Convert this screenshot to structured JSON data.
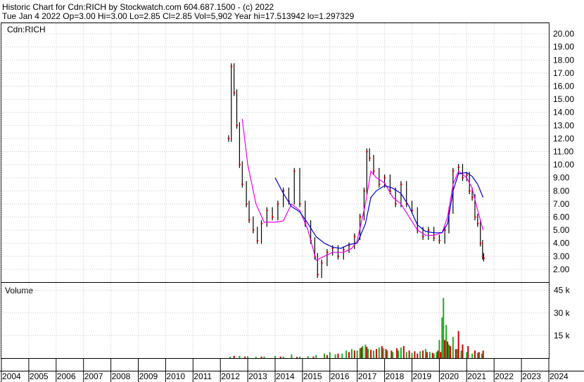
{
  "header": {
    "line1": "Historic Chart for Cdn:RICH by Stockwatch.com 604.687.1500 - (c) 2022",
    "line2": "Tue Jan  4 2022   Op=3.00  Hi=3.00  Lo=2.85  Cl=2.85  Vol=5,902  Year hi=17.513942  lo=1.297329"
  },
  "price_panel": {
    "label": "Cdn:RICH"
  },
  "volume_panel": {
    "label": "Volume"
  },
  "colors": {
    "price": "#000000",
    "close_marker": "#dd0000",
    "ma_short": "#ee00ee",
    "ma_long": "#0000cc",
    "vol_up": "#22aa22",
    "vol_down": "#cc0000"
  },
  "chart_data": [
    {
      "type": "line",
      "title": "Cdn:RICH",
      "x_ticks": [
        "2004",
        "2005",
        "2006",
        "2007",
        "2008",
        "2009",
        "2010",
        "2011",
        "2012",
        "2013",
        "2014",
        "2015",
        "2016",
        "2017",
        "2018",
        "2019",
        "2020",
        "2021",
        "2022",
        "2023",
        "2024"
      ],
      "xlim": [
        2004,
        2024
      ],
      "y_ticks": [
        "20.00",
        "19.00",
        "18.00",
        "17.00",
        "16.00",
        "15.00",
        "14.00",
        "13.00",
        "12.00",
        "11.00",
        "10.00",
        "9.00",
        "8.00",
        "7.00",
        "6.00",
        "5.00",
        "4.00",
        "3.00",
        "2.00"
      ],
      "ylim": [
        1.0,
        20.6
      ],
      "grid": true,
      "series": [
        {
          "values": [
            [
              2012.3,
              12.0
            ],
            [
              2012.4,
              17.5
            ],
            [
              2012.5,
              15.5
            ],
            [
              2012.6,
              13.0
            ],
            [
              2012.7,
              10.0
            ],
            [
              2012.8,
              8.5
            ],
            [
              2012.95,
              7.0
            ],
            [
              2013.05,
              5.8
            ],
            [
              2013.2,
              5.0
            ],
            [
              2013.35,
              4.2
            ],
            [
              2013.5,
              5.5
            ],
            [
              2013.7,
              6.5
            ],
            [
              2013.9,
              6.0
            ],
            [
              2014.1,
              7.0
            ],
            [
              2014.3,
              8.0
            ],
            [
              2014.5,
              7.2
            ],
            [
              2014.7,
              9.5
            ],
            [
              2014.9,
              7.0
            ],
            [
              2015.1,
              5.5
            ],
            [
              2015.3,
              4.2
            ],
            [
              2015.45,
              3.0
            ],
            [
              2015.55,
              1.6
            ],
            [
              2015.7,
              2.5
            ],
            [
              2015.9,
              3.3
            ],
            [
              2016.1,
              3.6
            ],
            [
              2016.3,
              3.0
            ],
            [
              2016.5,
              3.5
            ],
            [
              2016.7,
              3.8
            ],
            [
              2016.9,
              4.5
            ],
            [
              2017.1,
              6.0
            ],
            [
              2017.25,
              8.0
            ],
            [
              2017.35,
              11.0
            ],
            [
              2017.45,
              10.5
            ],
            [
              2017.6,
              9.5
            ],
            [
              2017.8,
              8.5
            ],
            [
              2018.0,
              9.0
            ],
            [
              2018.2,
              8.0
            ],
            [
              2018.4,
              7.0
            ],
            [
              2018.6,
              8.5
            ],
            [
              2018.8,
              7.0
            ],
            [
              2019.0,
              6.5
            ],
            [
              2019.2,
              5.0
            ],
            [
              2019.4,
              4.5
            ],
            [
              2019.6,
              5.0
            ],
            [
              2019.8,
              4.4
            ],
            [
              2020.0,
              4.2
            ],
            [
              2020.2,
              5.0
            ],
            [
              2020.35,
              6.5
            ],
            [
              2020.5,
              9.5
            ],
            [
              2020.7,
              9.8
            ],
            [
              2020.85,
              9.0
            ],
            [
              2021.0,
              9.2
            ],
            [
              2021.1,
              8.0
            ],
            [
              2021.2,
              7.5
            ],
            [
              2021.3,
              6.0
            ],
            [
              2021.4,
              5.5
            ],
            [
              2021.5,
              4.0
            ],
            [
              2021.58,
              3.0
            ],
            [
              2021.62,
              2.85
            ]
          ]
        },
        {
          "name": "",
          "values": [
            [
              2012.8,
              13.5
            ],
            [
              2013.0,
              10.0
            ],
            [
              2013.3,
              7.0
            ],
            [
              2013.6,
              5.6
            ],
            [
              2014.0,
              5.6
            ],
            [
              2014.3,
              5.7
            ],
            [
              2014.6,
              7.0
            ],
            [
              2014.9,
              6.5
            ],
            [
              2015.2,
              5.0
            ],
            [
              2015.5,
              2.7
            ],
            [
              2015.8,
              3.0
            ],
            [
              2016.1,
              3.3
            ],
            [
              2016.5,
              3.3
            ],
            [
              2016.8,
              3.6
            ],
            [
              2017.0,
              4.2
            ],
            [
              2017.3,
              7.0
            ],
            [
              2017.5,
              9.5
            ],
            [
              2017.7,
              9.0
            ],
            [
              2018.0,
              8.6
            ],
            [
              2018.3,
              7.5
            ],
            [
              2018.6,
              7.0
            ],
            [
              2018.9,
              6.0
            ],
            [
              2019.2,
              5.0
            ],
            [
              2019.5,
              4.6
            ],
            [
              2019.8,
              4.6
            ],
            [
              2020.1,
              4.8
            ],
            [
              2020.3,
              6.0
            ],
            [
              2020.5,
              8.5
            ],
            [
              2020.7,
              9.5
            ],
            [
              2021.0,
              9.0
            ],
            [
              2021.2,
              8.2
            ],
            [
              2021.4,
              6.5
            ],
            [
              2021.6,
              5.0
            ]
          ]
        },
        {
          "name": "",
          "values": [
            [
              2014.0,
              9.0
            ],
            [
              2014.3,
              7.8
            ],
            [
              2014.6,
              6.8
            ],
            [
              2014.9,
              6.4
            ],
            [
              2015.2,
              5.5
            ],
            [
              2015.5,
              4.5
            ],
            [
              2015.8,
              4.0
            ],
            [
              2016.1,
              3.7
            ],
            [
              2016.4,
              3.6
            ],
            [
              2016.7,
              3.9
            ],
            [
              2017.0,
              4.0
            ],
            [
              2017.3,
              5.5
            ],
            [
              2017.5,
              7.5
            ],
            [
              2017.7,
              8.0
            ],
            [
              2018.0,
              8.4
            ],
            [
              2018.3,
              8.2
            ],
            [
              2018.6,
              7.8
            ],
            [
              2018.9,
              6.8
            ],
            [
              2019.2,
              5.4
            ],
            [
              2019.5,
              4.9
            ],
            [
              2019.8,
              4.8
            ],
            [
              2020.1,
              4.8
            ],
            [
              2020.3,
              5.5
            ],
            [
              2020.5,
              8.0
            ],
            [
              2020.7,
              9.3
            ],
            [
              2021.0,
              9.4
            ],
            [
              2021.2,
              9.1
            ],
            [
              2021.4,
              8.5
            ],
            [
              2021.6,
              7.5
            ]
          ]
        }
      ]
    },
    {
      "type": "bar",
      "title": "Volume",
      "y_ticks": [
        "45 k",
        "30 k",
        "15 k"
      ],
      "ylim": [
        0,
        50
      ],
      "grid": true,
      "series": [
        {
          "values": [
            [
              2012.35,
              1.0
            ],
            [
              2012.7,
              1.5
            ],
            [
              2013.0,
              1.2
            ],
            [
              2013.3,
              0.8
            ],
            [
              2013.6,
              1.0
            ],
            [
              2014.0,
              1.5
            ],
            [
              2014.3,
              1.0
            ],
            [
              2014.6,
              2.5
            ],
            [
              2014.9,
              1.0
            ],
            [
              2015.2,
              1.2
            ],
            [
              2015.5,
              2.0
            ],
            [
              2015.8,
              3.0
            ],
            [
              2016.0,
              4.0
            ],
            [
              2016.2,
              2.5
            ],
            [
              2016.45,
              3.0
            ],
            [
              2016.6,
              5.0
            ],
            [
              2016.8,
              6.0
            ],
            [
              2017.0,
              5.0
            ],
            [
              2017.1,
              6.5
            ],
            [
              2017.2,
              8.0
            ],
            [
              2017.3,
              9.0
            ],
            [
              2017.4,
              6.0
            ],
            [
              2017.6,
              5.0
            ],
            [
              2017.8,
              7.0
            ],
            [
              2017.95,
              6.5
            ],
            [
              2018.1,
              5.0
            ],
            [
              2018.3,
              4.0
            ],
            [
              2018.5,
              5.0
            ],
            [
              2018.6,
              7.0
            ],
            [
              2018.8,
              4.0
            ],
            [
              2019.0,
              3.5
            ],
            [
              2019.3,
              4.5
            ],
            [
              2019.5,
              6.0
            ],
            [
              2019.65,
              4.0
            ],
            [
              2019.8,
              3.0
            ],
            [
              2019.9,
              4.0
            ],
            [
              2020.0,
              12.0
            ],
            [
              2020.1,
              27.0
            ],
            [
              2020.15,
              40.0
            ],
            [
              2020.25,
              22.0
            ],
            [
              2020.35,
              9.0
            ],
            [
              2020.5,
              14.0
            ],
            [
              2020.65,
              6.0
            ],
            [
              2020.8,
              5.0
            ],
            [
              2021.0,
              4.0
            ],
            [
              2021.2,
              3.0
            ],
            [
              2021.4,
              3.5
            ],
            [
              2021.55,
              3.0
            ]
          ]
        },
        {
          "values": [
            [
              2012.5,
              1.5
            ],
            [
              2012.9,
              1.0
            ],
            [
              2013.5,
              1.0
            ],
            [
              2014.2,
              1.0
            ],
            [
              2014.8,
              0.8
            ],
            [
              2015.4,
              1.0
            ],
            [
              2015.9,
              2.0
            ],
            [
              2016.3,
              3.0
            ],
            [
              2016.7,
              4.0
            ],
            [
              2016.9,
              5.0
            ],
            [
              2017.15,
              7.0
            ],
            [
              2017.35,
              7.5
            ],
            [
              2017.5,
              5.5
            ],
            [
              2017.7,
              6.0
            ],
            [
              2017.9,
              8.0
            ],
            [
              2018.05,
              6.0
            ],
            [
              2018.25,
              5.0
            ],
            [
              2018.45,
              6.5
            ],
            [
              2018.7,
              8.0
            ],
            [
              2018.9,
              5.0
            ],
            [
              2019.1,
              4.5
            ],
            [
              2019.2,
              3.0
            ],
            [
              2019.4,
              5.0
            ],
            [
              2019.55,
              4.0
            ],
            [
              2019.75,
              3.5
            ],
            [
              2019.95,
              5.0
            ],
            [
              2020.05,
              4.0
            ],
            [
              2020.2,
              12.0
            ],
            [
              2020.3,
              11.0
            ],
            [
              2020.4,
              8.0
            ],
            [
              2020.6,
              6.0
            ],
            [
              2020.7,
              18.0
            ],
            [
              2020.85,
              9.0
            ],
            [
              2021.05,
              8.0
            ],
            [
              2021.3,
              5.0
            ],
            [
              2021.45,
              4.0
            ],
            [
              2021.6,
              5.0
            ]
          ]
        }
      ]
    }
  ]
}
